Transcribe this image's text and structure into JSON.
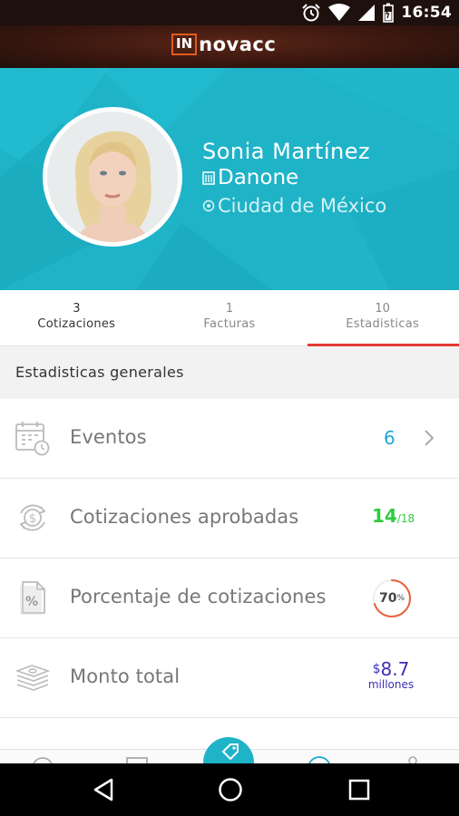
{
  "status_bar": {
    "time": "16:54"
  },
  "app_bar": {
    "logo_box": "IN",
    "logo_rest": "novacc"
  },
  "profile": {
    "name": "Sonia Martínez",
    "company": "Danone",
    "city": "Ciudad de México"
  },
  "tabs": [
    {
      "count": "3",
      "label": "Cotizaciones"
    },
    {
      "count": "1",
      "label": "Facturas"
    },
    {
      "count": "10",
      "label": "Estadisticas"
    }
  ],
  "section_title": "Estadisticas generales",
  "stats": {
    "events": {
      "label": "Eventos",
      "value": "6"
    },
    "approved": {
      "label": "Cotizaciones aprobadas",
      "value": "14",
      "total": "/18"
    },
    "percentage": {
      "label": "Porcentaje de cotizaciones",
      "value": "70",
      "unit": "%",
      "fraction": 0.7
    },
    "amount": {
      "label": "Monto total",
      "currency": "$",
      "value": "8.7",
      "unit": "millones"
    }
  },
  "colors": {
    "accent": "#1fb3c8",
    "active_tab": "#e53935",
    "events_value": "#1ea7d4",
    "approved_value": "#2ecc40",
    "amount_value": "#3d2fb8",
    "percentage_ring": "#e8603c"
  }
}
